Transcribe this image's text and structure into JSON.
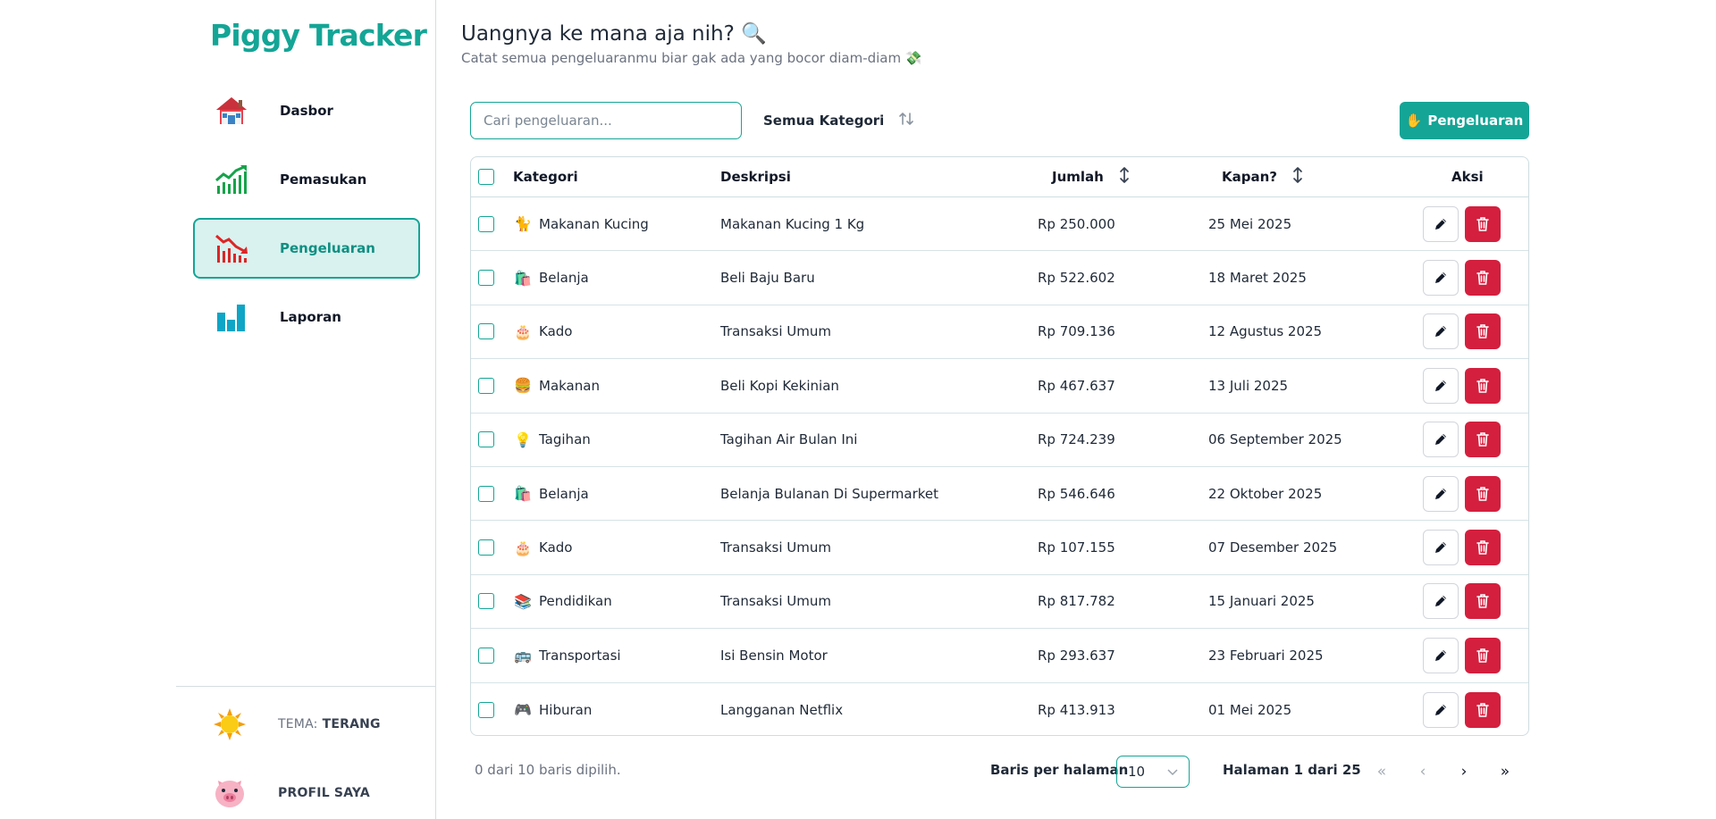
{
  "app": {
    "brand": "Piggy Tracker",
    "accent": "#14a596",
    "danger": "#d41f3e"
  },
  "sidebar": {
    "items": [
      {
        "label": "Dasbor",
        "icon": "house-icon",
        "active": false
      },
      {
        "label": "Pemasukan",
        "icon": "chart-up-icon",
        "active": false
      },
      {
        "label": "Pengeluaran",
        "icon": "chart-down-icon",
        "active": true
      },
      {
        "label": "Laporan",
        "icon": "bar-chart-icon",
        "active": false
      }
    ],
    "theme": {
      "prefix": "TEMA:",
      "value": "TERANG",
      "icon": "sun-icon"
    },
    "profile": {
      "label": "PROFIL SAYA",
      "icon": "pig-icon"
    }
  },
  "header": {
    "title": "Uangnya ke mana aja nih? 🔍",
    "subtitle": "Catat semua pengeluaranmu biar gak ada yang bocor diam-diam 💸"
  },
  "toolbar": {
    "search_placeholder": "Cari pengeluaran...",
    "category_filter": "Semua Kategori",
    "add_label": "Pengeluaran",
    "add_icon": "✋"
  },
  "table": {
    "headers": {
      "category": "Kategori",
      "description": "Deskripsi",
      "amount": "Jumlah",
      "date": "Kapan?",
      "actions": "Aksi"
    },
    "rows": [
      {
        "emoji": "🐈",
        "category": "Makanan Kucing",
        "description": "Makanan Kucing 1 Kg",
        "amount": "Rp 250.000",
        "date": "25 Mei 2025"
      },
      {
        "emoji": "🛍️",
        "category": "Belanja",
        "description": "Beli Baju Baru",
        "amount": "Rp 522.602",
        "date": "18 Maret 2025"
      },
      {
        "emoji": "🎂",
        "category": "Kado",
        "description": "Transaksi Umum",
        "amount": "Rp 709.136",
        "date": "12 Agustus 2025"
      },
      {
        "emoji": "🍔",
        "category": "Makanan",
        "description": "Beli Kopi Kekinian",
        "amount": "Rp 467.637",
        "date": "13 Juli 2025"
      },
      {
        "emoji": "💡",
        "category": "Tagihan",
        "description": "Tagihan Air Bulan Ini",
        "amount": "Rp 724.239",
        "date": "06 September 2025"
      },
      {
        "emoji": "🛍️",
        "category": "Belanja",
        "description": "Belanja Bulanan Di Supermarket",
        "amount": "Rp 546.646",
        "date": "22 Oktober 2025"
      },
      {
        "emoji": "🎂",
        "category": "Kado",
        "description": "Transaksi Umum",
        "amount": "Rp 107.155",
        "date": "07 Desember 2025"
      },
      {
        "emoji": "📚",
        "category": "Pendidikan",
        "description": "Transaksi Umum",
        "amount": "Rp 817.782",
        "date": "15 Januari 2025"
      },
      {
        "emoji": "🚌",
        "category": "Transportasi",
        "description": "Isi Bensin Motor",
        "amount": "Rp 293.637",
        "date": "23 Februari 2025"
      },
      {
        "emoji": "🎮",
        "category": "Hiburan",
        "description": "Langganan Netflix",
        "amount": "Rp 413.913",
        "date": "01 Mei 2025"
      }
    ]
  },
  "footer": {
    "selected_text": "0 dari 10 baris dipilih.",
    "rows_per_page_label": "Baris per halaman",
    "rows_per_page": "10",
    "page_info": "Halaman 1 dari 25",
    "first": "«",
    "prev": "‹",
    "next": "›",
    "last": "»"
  }
}
